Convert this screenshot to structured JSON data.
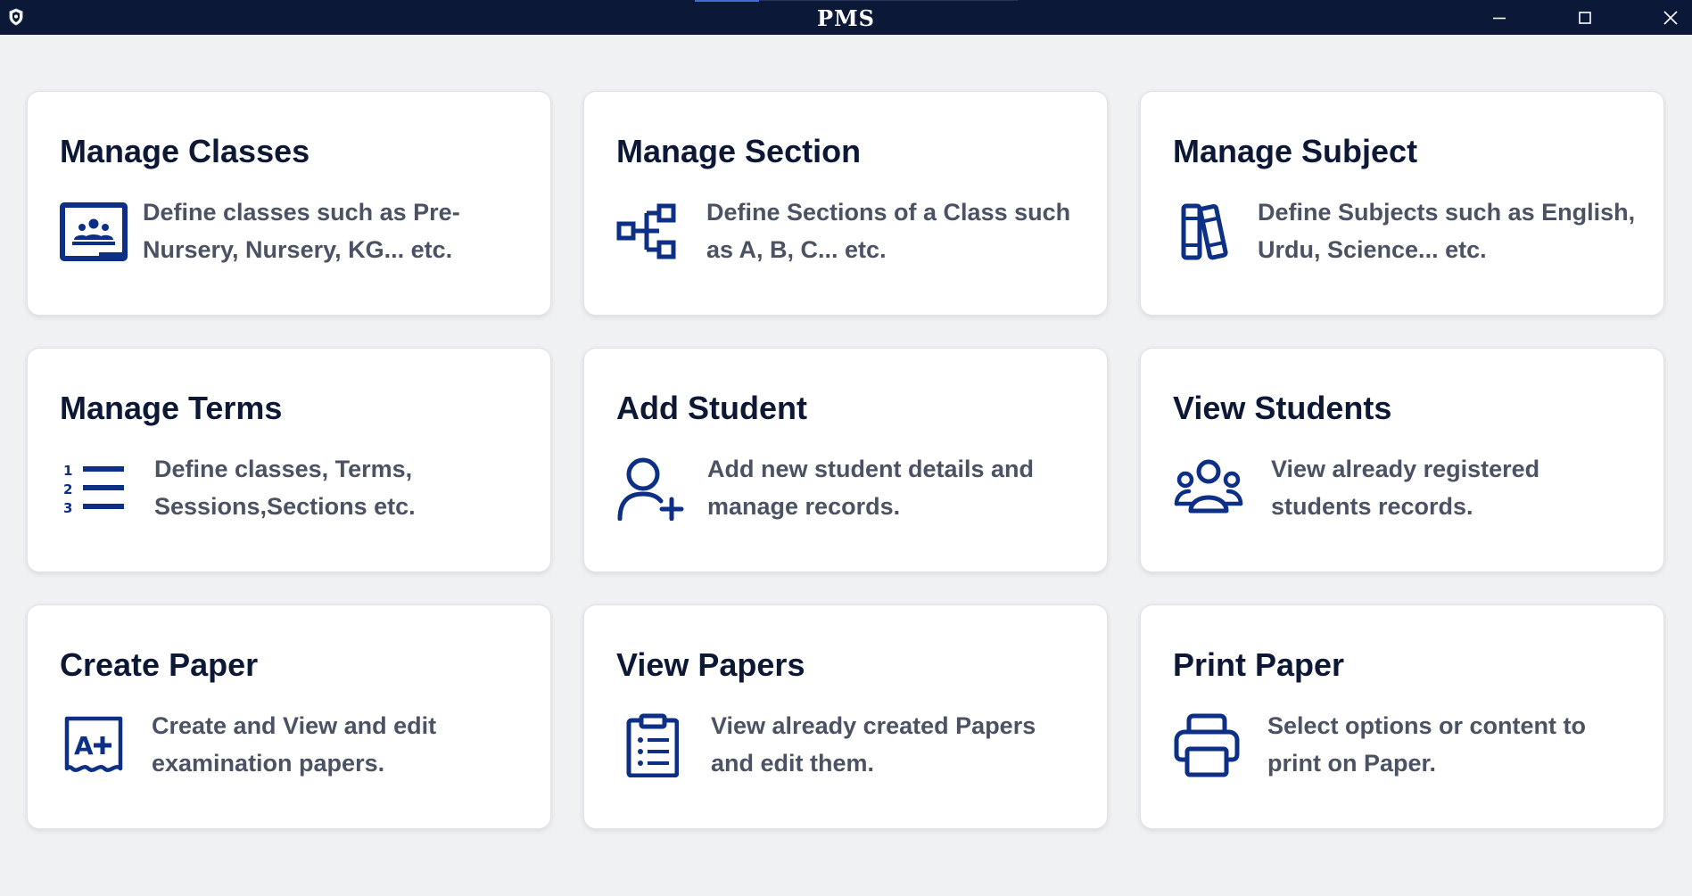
{
  "window": {
    "title": "PMS",
    "controls": {
      "minimize": "—",
      "maximize": "☐",
      "close": "✕"
    }
  },
  "cards": [
    {
      "title": "Manage Classes",
      "description_lines": [
        "Define classes such as Pre-",
        "Nursery, Nursery, KG... etc."
      ],
      "icon": "classroom-board-icon"
    },
    {
      "title": "Manage Section",
      "description_lines": [
        "Define Sections of a Class such",
        "as A, B, C... etc."
      ],
      "icon": "hierarchy-icon"
    },
    {
      "title": "Manage Subject",
      "description_lines": [
        "Define Subjects such as English,",
        "Urdu, Science... etc."
      ],
      "icon": "books-icon"
    },
    {
      "title": "Manage Terms",
      "description_lines": [
        "Define classes, Terms,",
        "Sessions,Sections etc."
      ],
      "icon": "numbered-list-icon"
    },
    {
      "title": "Add Student",
      "description_lines": [
        "Add new student details and",
        "manage records."
      ],
      "icon": "user-add-icon"
    },
    {
      "title": "View Students",
      "description_lines": [
        "View already registered",
        "students records."
      ],
      "icon": "users-group-icon"
    },
    {
      "title": "Create Paper",
      "description_lines": [
        "Create and View and edit",
        "examination papers."
      ],
      "icon": "grade-paper-icon"
    },
    {
      "title": "View Papers",
      "description_lines": [
        "View already created Papers",
        "and edit them."
      ],
      "icon": "clipboard-list-icon"
    },
    {
      "title": "Print Paper",
      "description_lines": [
        "Select options or content to",
        "print on Paper."
      ],
      "icon": "printer-icon"
    }
  ],
  "colors": {
    "titlebar": "#0b1838",
    "background": "#f0f1f3",
    "card": "#ffffff",
    "title_text": "#0c1836",
    "desc_text": "#4b5263",
    "icon": "#0d2f86"
  }
}
